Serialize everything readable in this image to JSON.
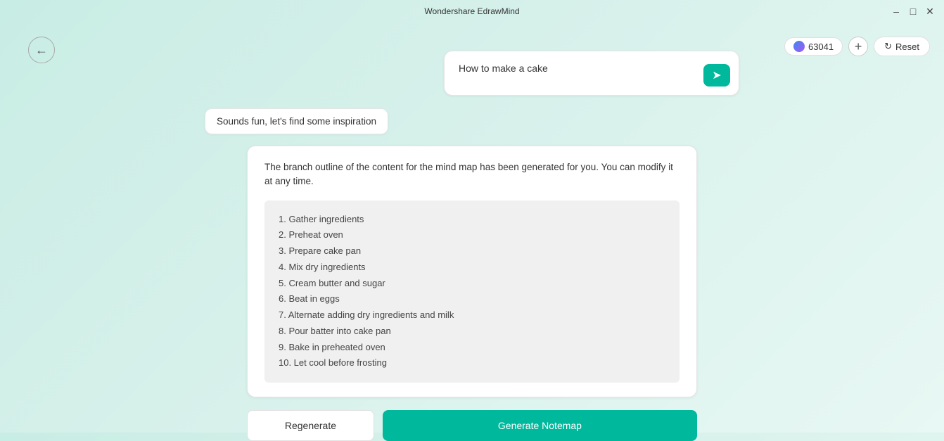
{
  "titleBar": {
    "title": "Wondershare EdrawMind",
    "minimizeLabel": "–",
    "maximizeLabel": "□",
    "closeLabel": "✕"
  },
  "toolbar": {
    "credits": "63041",
    "addLabel": "+",
    "resetLabel": "Reset"
  },
  "userMessage": {
    "text": "How to make a cake",
    "sendIcon": "➤"
  },
  "aiResponse": {
    "text": "Sounds fun, let's find some inspiration"
  },
  "outlineCard": {
    "description": "The branch outline of the content for the mind map has been generated for you. You can modify it at any time.",
    "items": [
      "1. Gather ingredients",
      "2. Preheat oven",
      "3. Prepare cake pan",
      "4. Mix dry ingredients",
      "5. Cream butter and sugar",
      "6. Beat in eggs",
      "7. Alternate adding dry ingredients and milk",
      "8. Pour batter into cake pan",
      "9. Bake in preheated oven",
      "10. Let cool before frosting"
    ]
  },
  "buttons": {
    "regenerate": "Regenerate",
    "generate": "Generate Notemap"
  }
}
